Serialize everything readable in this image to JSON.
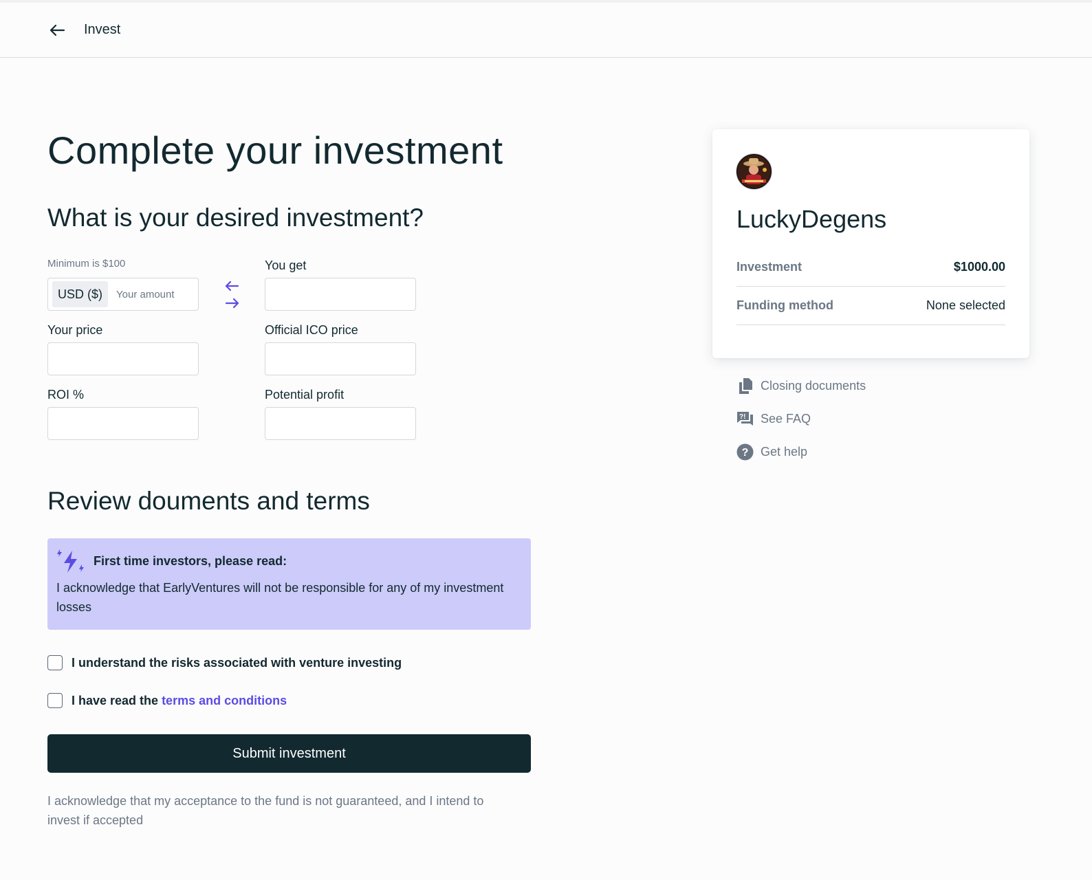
{
  "header": {
    "title": "Invest"
  },
  "main": {
    "title": "Complete your investment",
    "investment_section": {
      "title": "What is your desired investment?",
      "minimum_note": "Minimum is $100",
      "currency": "USD ($)",
      "amount_placeholder": "Your amount",
      "you_get_label": "You get",
      "your_price_label": "Your price",
      "official_price_label": "Official ICO price",
      "roi_label": "ROI %",
      "profit_label": "Potential profit"
    },
    "review_section": {
      "title": "Review douments and terms",
      "notice_title": "First time investors, please read:",
      "notice_text": "I acknowledge that EarlyVentures will not be responsible for any of my investment losses",
      "check_risks": "I understand the risks associated with venture investing",
      "check_terms_prefix": "I have read the ",
      "check_terms_link": "terms and conditions"
    },
    "submit_label": "Submit investment",
    "disclaimer": "I acknowledge that my acceptance to the fund is not guaranteed, and I intend to invest if accepted"
  },
  "summary": {
    "company": "LuckyDegens",
    "investment_label": "Investment",
    "investment_value": "$1000.00",
    "funding_label": "Funding method",
    "funding_value": "None selected"
  },
  "side_links": [
    {
      "label": "Closing documents",
      "icon": "document-icon"
    },
    {
      "label": "See FAQ",
      "icon": "faq-icon"
    },
    {
      "label": "Get help",
      "icon": "help-icon"
    }
  ],
  "colors": {
    "primary": "#12292f",
    "accent": "#5b4ce6",
    "notice_bg": "#cccbf9",
    "muted": "#6b7785"
  }
}
